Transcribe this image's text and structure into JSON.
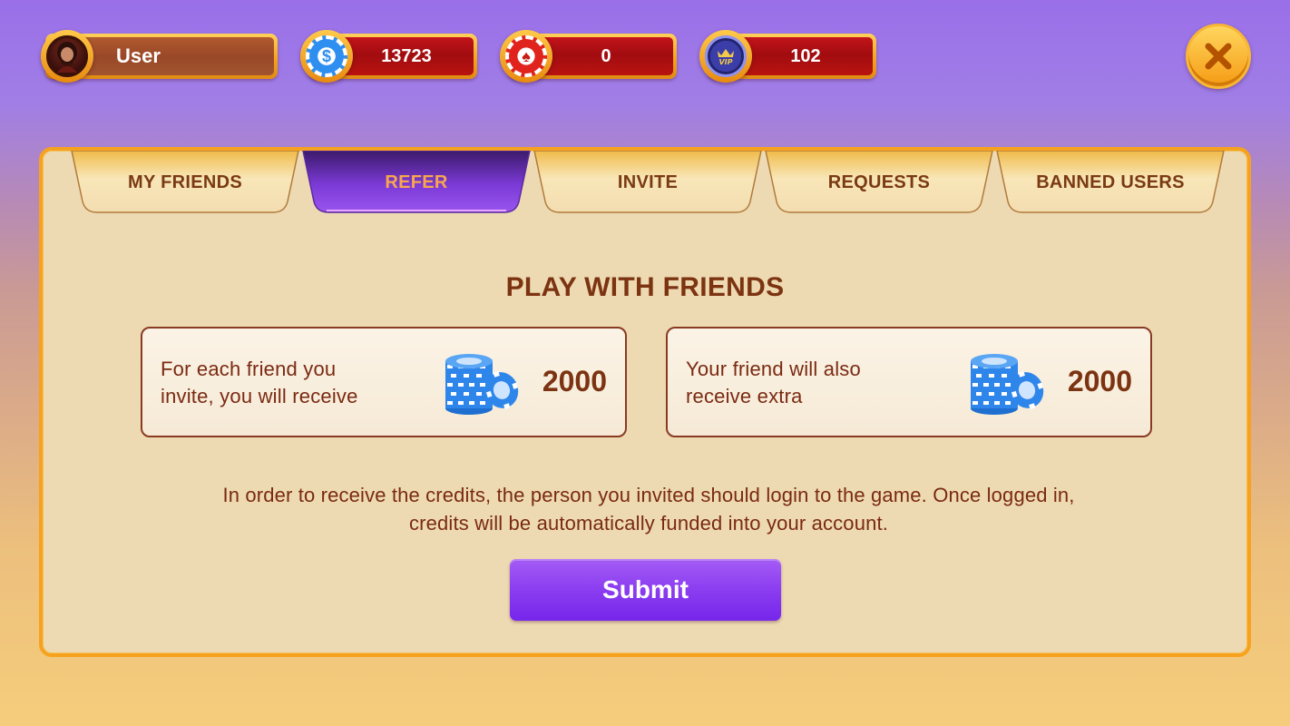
{
  "header": {
    "user": {
      "name": "User",
      "avatar_icon": "avatar-icon"
    },
    "currencies": [
      {
        "name": "coins",
        "icon": "dollar-chip-icon",
        "value": "13723"
      },
      {
        "name": "chips",
        "icon": "spade-chip-icon",
        "value": "0"
      },
      {
        "name": "vip",
        "icon": "vip-coin-icon",
        "value": "102"
      }
    ],
    "close_icon": "close-icon"
  },
  "tabs": [
    {
      "label": "MY FRIENDS",
      "active": false
    },
    {
      "label": "REFER",
      "active": true
    },
    {
      "label": "INVITE",
      "active": false
    },
    {
      "label": "REQUESTS",
      "active": false
    },
    {
      "label": "BANNED USERS",
      "active": false
    }
  ],
  "refer": {
    "title": "PLAY WITH FRIENDS",
    "cards": [
      {
        "text_line1": "For each friend you",
        "text_line2": "invite, you will receive",
        "amount": "2000",
        "icon": "chip-stack-icon"
      },
      {
        "text_line1": "Your friend will also",
        "text_line2": "receive extra",
        "amount": "2000",
        "icon": "chip-stack-icon"
      }
    ],
    "info_line1": "In order to receive the credits, the person you invited should login to the game. Once logged in,",
    "info_line2": "credits will be automatically funded into your account.",
    "submit_label": "Submit"
  },
  "colors": {
    "accent_orange": "#f6a21f",
    "panel_bg": "#eddab2",
    "text_brown": "#7c3311",
    "submit_purple": "#8b3df0",
    "active_tab_purple": "#8c3fe0"
  }
}
